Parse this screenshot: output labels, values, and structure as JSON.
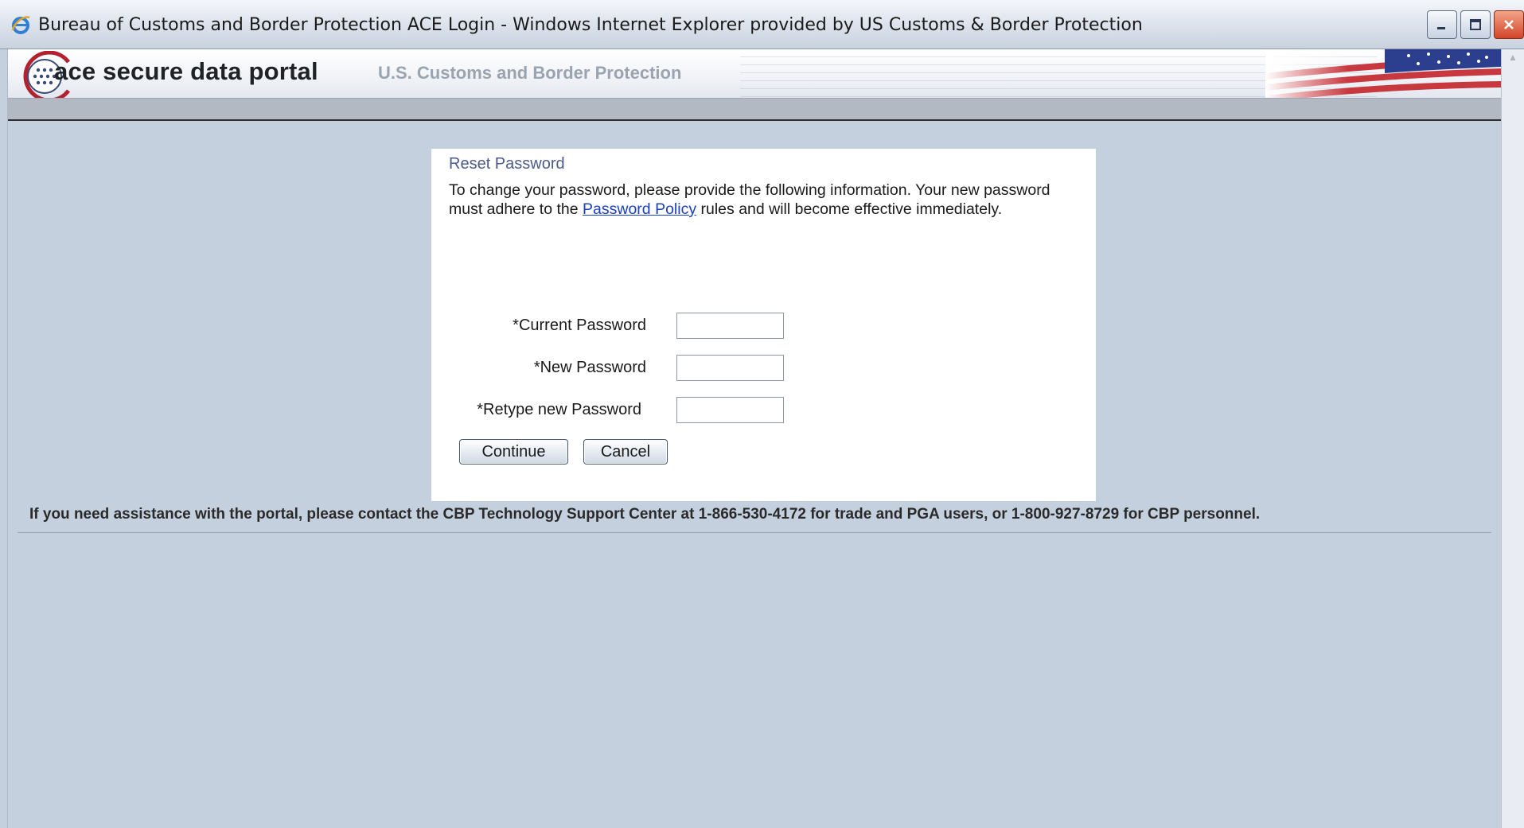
{
  "window": {
    "title": "Bureau of Customs and Border Protection ACE Login - Windows Internet Explorer provided by US Customs & Border Protection",
    "icon": "ie-icon",
    "controls": [
      "minimize-icon",
      "maximize-icon",
      "close-icon"
    ]
  },
  "banner": {
    "brand": "ace secure data portal",
    "subtitle": "U.S. Customs and Border Protection"
  },
  "panel": {
    "title": "Reset Password",
    "intro_before": "To change your password, please provide the following information. Your new password must adhere to the ",
    "policy_link": "Password Policy",
    "intro_after": " rules and will become effective immediately.",
    "fields": [
      {
        "label": "*Current Password",
        "value": "",
        "placeholder": ""
      },
      {
        "label": "*New Password",
        "value": "",
        "placeholder": ""
      },
      {
        "label": "*Retype new Password",
        "value": "",
        "placeholder": ""
      }
    ],
    "continue_label": "Continue",
    "cancel_label": "Cancel"
  },
  "support": {
    "text": "If you need assistance with the portal, please contact the CBP Technology Support Center at 1-866-530-4172 for trade and PGA users, or 1-800-927-8729 for CBP personnel."
  },
  "colors": {
    "page_background": "#c4d0de",
    "panel_title": "#4b5b8a",
    "link": "#1a3fbf",
    "close_button": "#d2452a"
  }
}
